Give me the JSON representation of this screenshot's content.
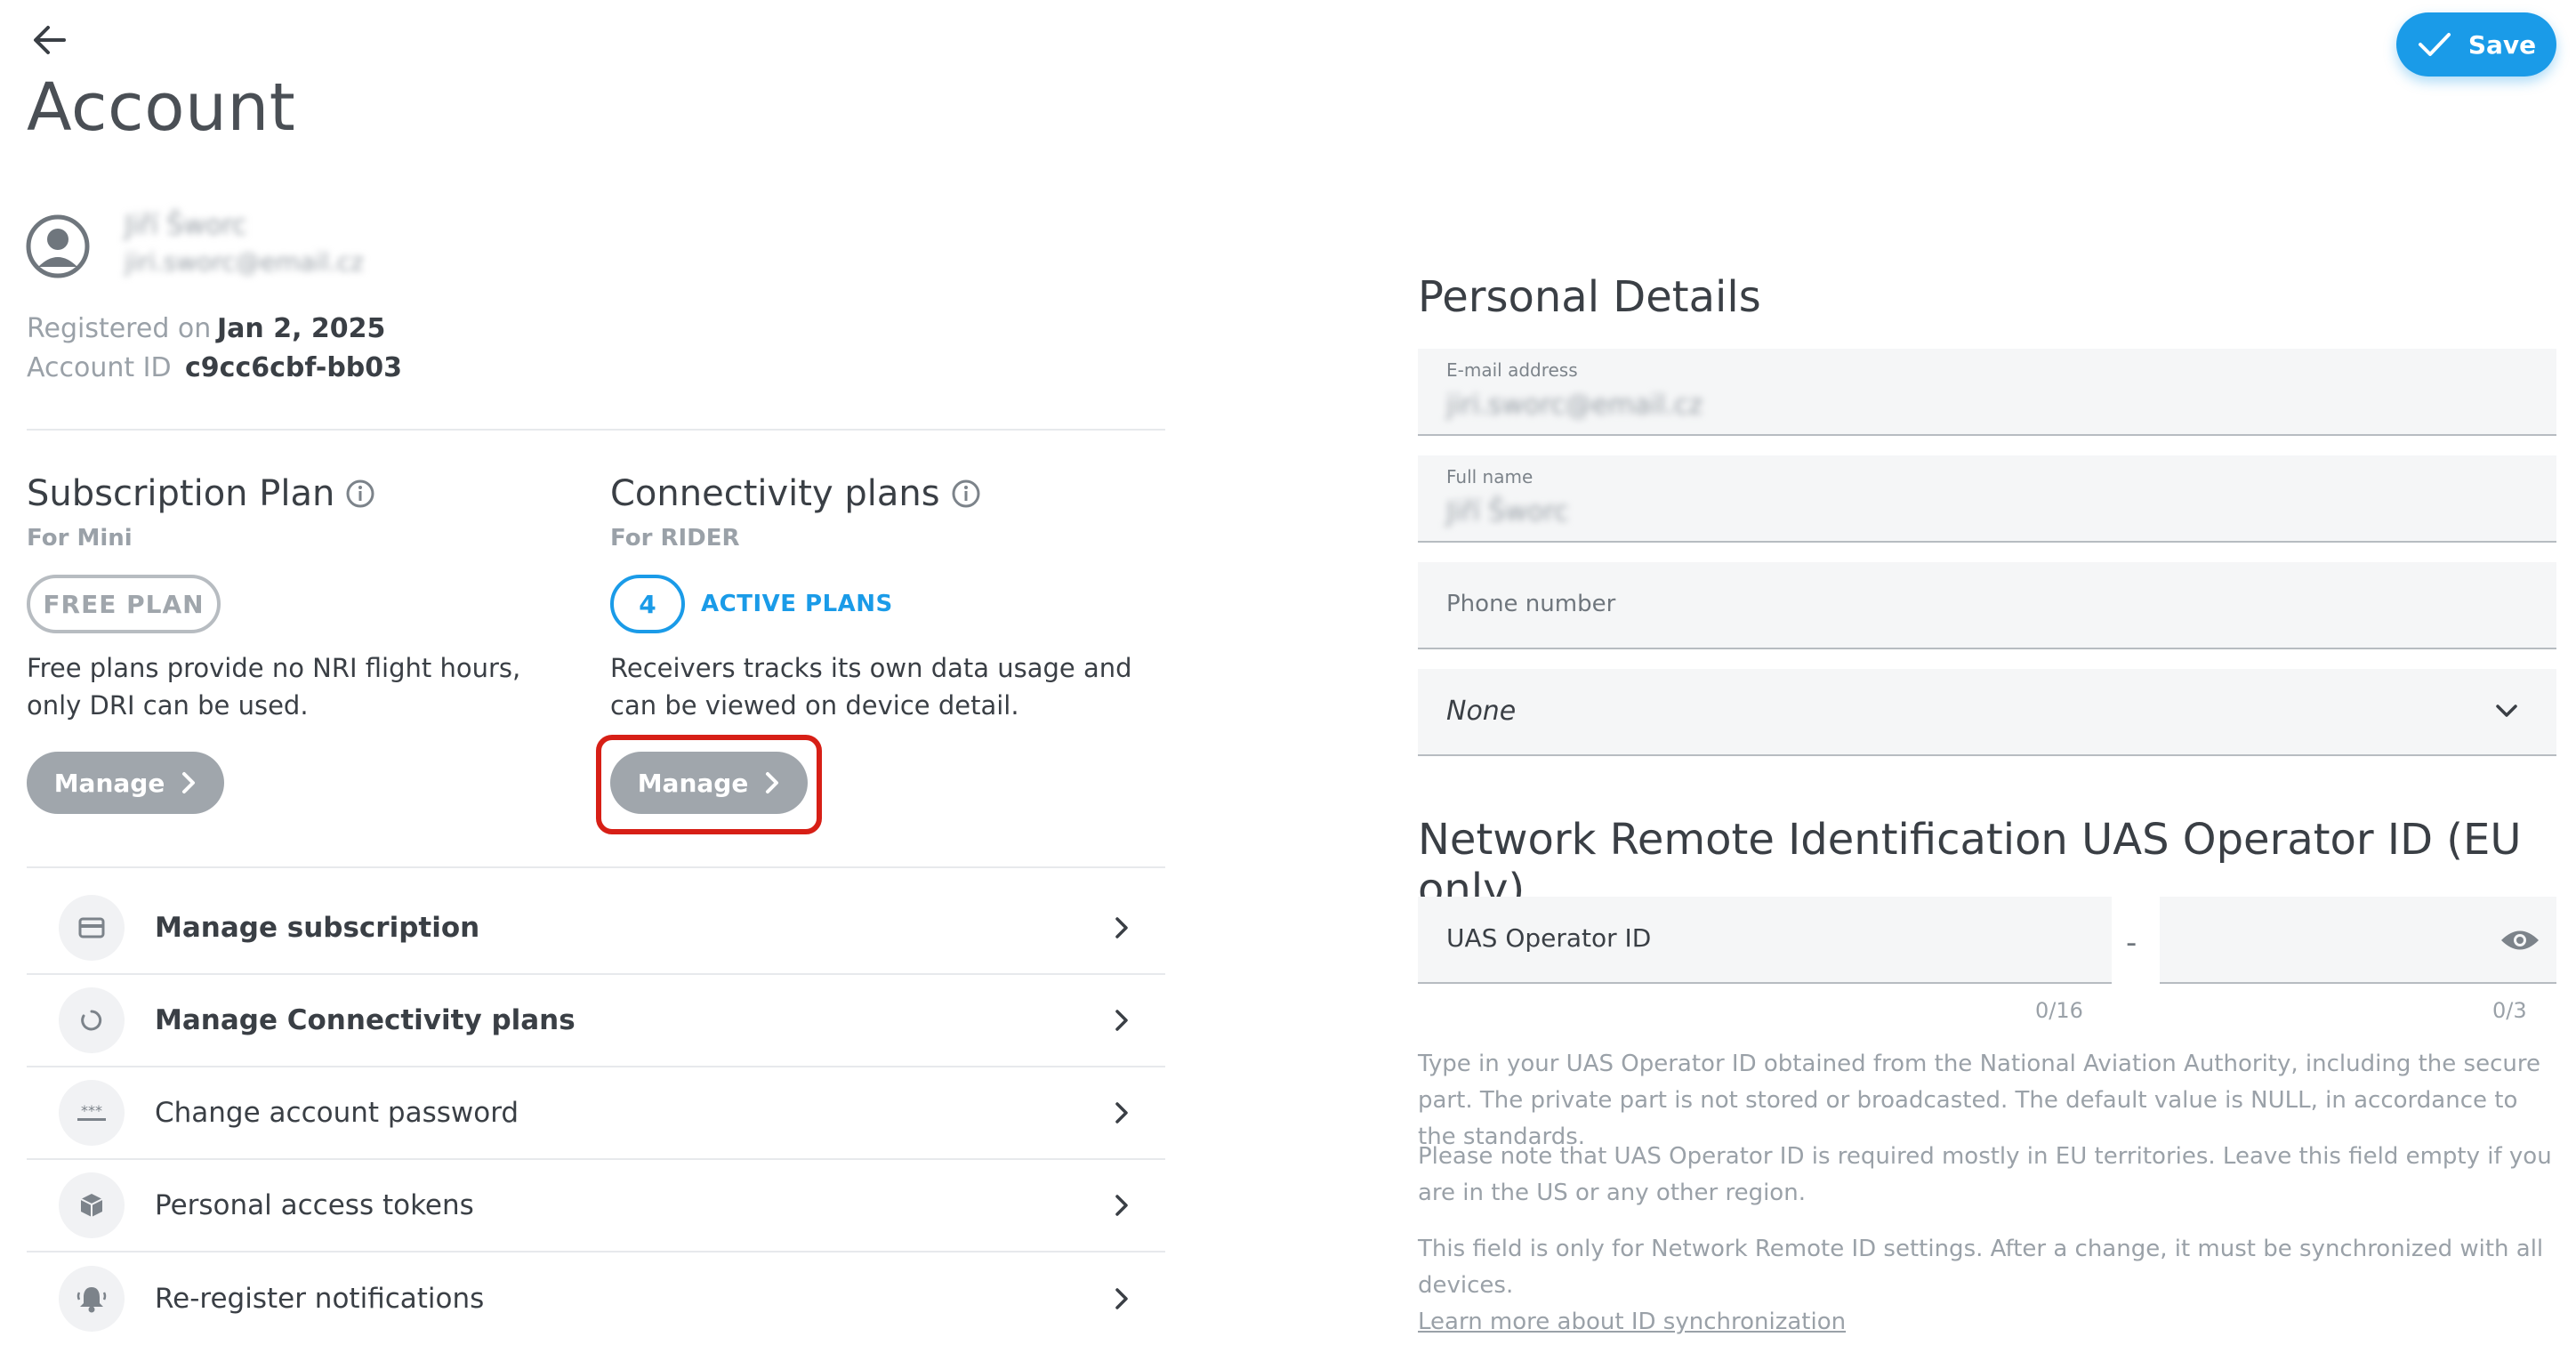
{
  "header": {
    "title": "Account",
    "save_label": "Save"
  },
  "profile": {
    "name": "Jiří Šworc",
    "email": "jiri.sworc@email.cz",
    "registered_label": "Registered on",
    "registered_value": "Jan 2, 2025",
    "account_id_label": "Account ID",
    "account_id_value": "c9cc6cbf-bb03"
  },
  "subscription": {
    "title": "Subscription Plan",
    "subtitle": "For Mini",
    "badge": "FREE PLAN",
    "description": "Free plans provide no NRI flight hours, only DRI can be used.",
    "manage_label": "Manage"
  },
  "connectivity": {
    "title": "Connectivity plans",
    "subtitle": "For RIDER",
    "count": "4",
    "count_label": "ACTIVE PLANS",
    "description": "Receivers tracks its own data usage and can be viewed on device detail.",
    "manage_label": "Manage"
  },
  "menu": [
    {
      "label": "Manage subscription",
      "icon": "credit-card-icon"
    },
    {
      "label": "Manage Connectivity plans",
      "icon": "circle-refresh-icon"
    },
    {
      "label": "Change account password",
      "icon": "password-dots-icon"
    },
    {
      "label": "Personal access tokens",
      "icon": "cube-icon"
    },
    {
      "label": "Re-register notifications",
      "icon": "bell-icon"
    }
  ],
  "personal_details": {
    "title": "Personal Details",
    "email_label": "E-mail address",
    "email_value": "jiri.sworc@email.cz",
    "fullname_label": "Full name",
    "fullname_value": "Jiří Šworc",
    "phone_placeholder": "Phone number",
    "select_value": "None"
  },
  "nri": {
    "title": "Network Remote Identification UAS Operator ID (EU only)",
    "operator_placeholder": "UAS Operator ID",
    "separator": "-",
    "counter_main": "0/16",
    "counter_secure": "0/3",
    "help_1": "Type in your UAS Operator ID obtained from the National Aviation Authority, including the secure part. The private part is not stored or broadcasted. The default value is NULL, in accordance to the standards.",
    "help_2": "Please note that UAS Operator ID is required mostly in EU territories. Leave this field empty if you are in the US or any other region.",
    "help_3": "This field is only for Network Remote ID settings. After a change, it must be synchronized with all devices.",
    "help_link": "Learn more about ID synchronization"
  },
  "colors": {
    "accent": "#1a9be8",
    "highlight": "#d71f16",
    "muted_button": "#a0a6ac"
  }
}
